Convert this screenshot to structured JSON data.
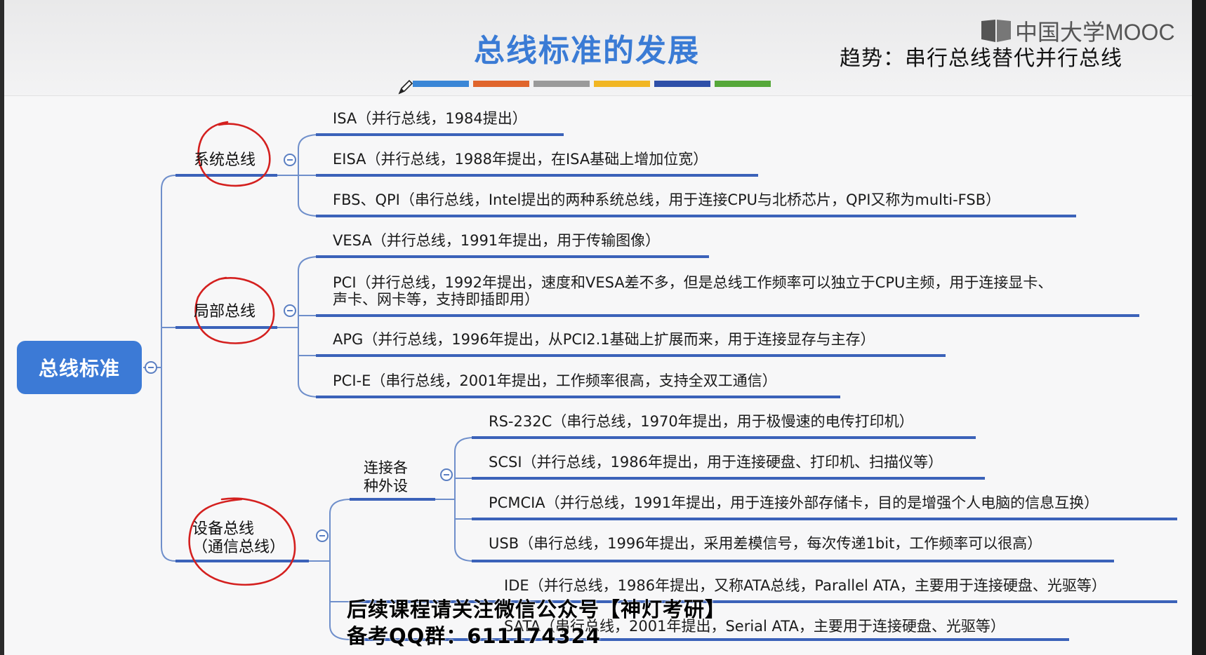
{
  "header": {
    "title": "总线标准的发展",
    "subtitle": "趋势：串行总线替代并行总线",
    "logo_text": "中国大学MOOC",
    "logo_icon": "mooc-book-icon",
    "stripe_colors": [
      "#3a86d6",
      "#e0652c",
      "#9a9a9a",
      "#f1b623",
      "#2e4fa8",
      "#56a83a"
    ]
  },
  "mindmap": {
    "root": "总线标准",
    "system_bus": {
      "label": "系统总线",
      "items": [
        "ISA（并行总线，1984提出）",
        "EISA（并行总线，1988年提出，在ISA基础上增加位宽）",
        "FBS、QPI（串行总线，Intel提出的两种系统总线，用于连接CPU与北桥芯片，QPI又称为multi-FSB）"
      ]
    },
    "local_bus": {
      "label": "局部总线",
      "items": [
        "VESA（并行总线，1991年提出，用于传输图像）",
        "PCI（并行总线，1992年提出，速度和VESA差不多，但是总线工作频率可以独立于CPU主频，用于连接显卡、",
        "声卡、网卡等，支持即插即用）",
        "APG（并行总线，1996年提出，从PCI2.1基础上扩展而来，用于连接显存与主存）",
        "PCI-E（串行总线，2001年提出，工作频率很高，支持全双工通信）"
      ]
    },
    "device_bus": {
      "label_line1": "设备总线",
      "label_line2": "（通信总线）",
      "peripheral_group": {
        "label_line1": "连接各",
        "label_line2": "种外设",
        "items": [
          "RS-232C（串行总线，1970年提出，用于极慢速的电传打印机）",
          "SCSI（并行总线，1986年提出，用于连接硬盘、打印机、扫描仪等）",
          "PCMCIA（并行总线，1991年提出，用于连接外部存储卡，目的是增强个人电脑的信息互换）",
          "USB（串行总线，1996年提出，采用差模信号，每次传递1bit，工作频率可以很高）"
        ]
      },
      "items": [
        "IDE（并行总线，1986年提出，又称ATA总线，Parallel ATA，主要用于连接硬盘、光驱等）",
        "SATA（串行总线，2001年提出，Serial ATA，主要用于连接硬盘、光驱等）"
      ]
    }
  },
  "watermark": {
    "line1": "后续课程请关注微信公众号【神灯考研】",
    "line2": "备考QQ群：611174324"
  }
}
